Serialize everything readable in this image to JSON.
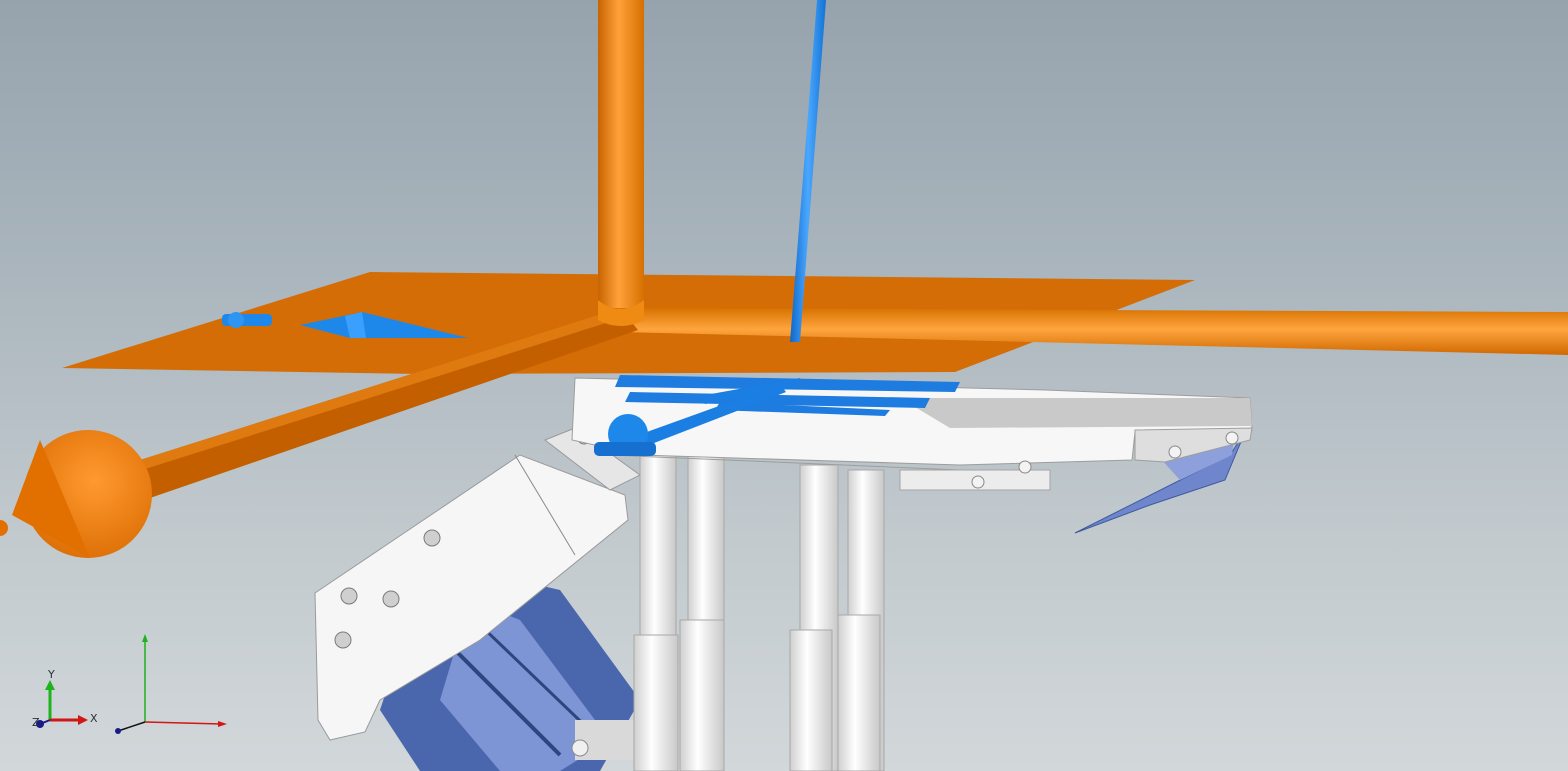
{
  "viewport": {
    "background_top": "#96a3ad",
    "background_bottom": "#d2d7da"
  },
  "colors": {
    "orange_rod": "#ff8a00",
    "orange_plane": "#d86a06",
    "blue_part": "#1e88ea",
    "steel_blue": "#5570b8",
    "white_part": "#f4f4f4"
  },
  "triad": {
    "y_label": "Y",
    "x_label": "X",
    "z_label": "Z"
  },
  "icons": {
    "triad": "view-triad-icon",
    "origin_axes": "origin-axes-icon"
  }
}
